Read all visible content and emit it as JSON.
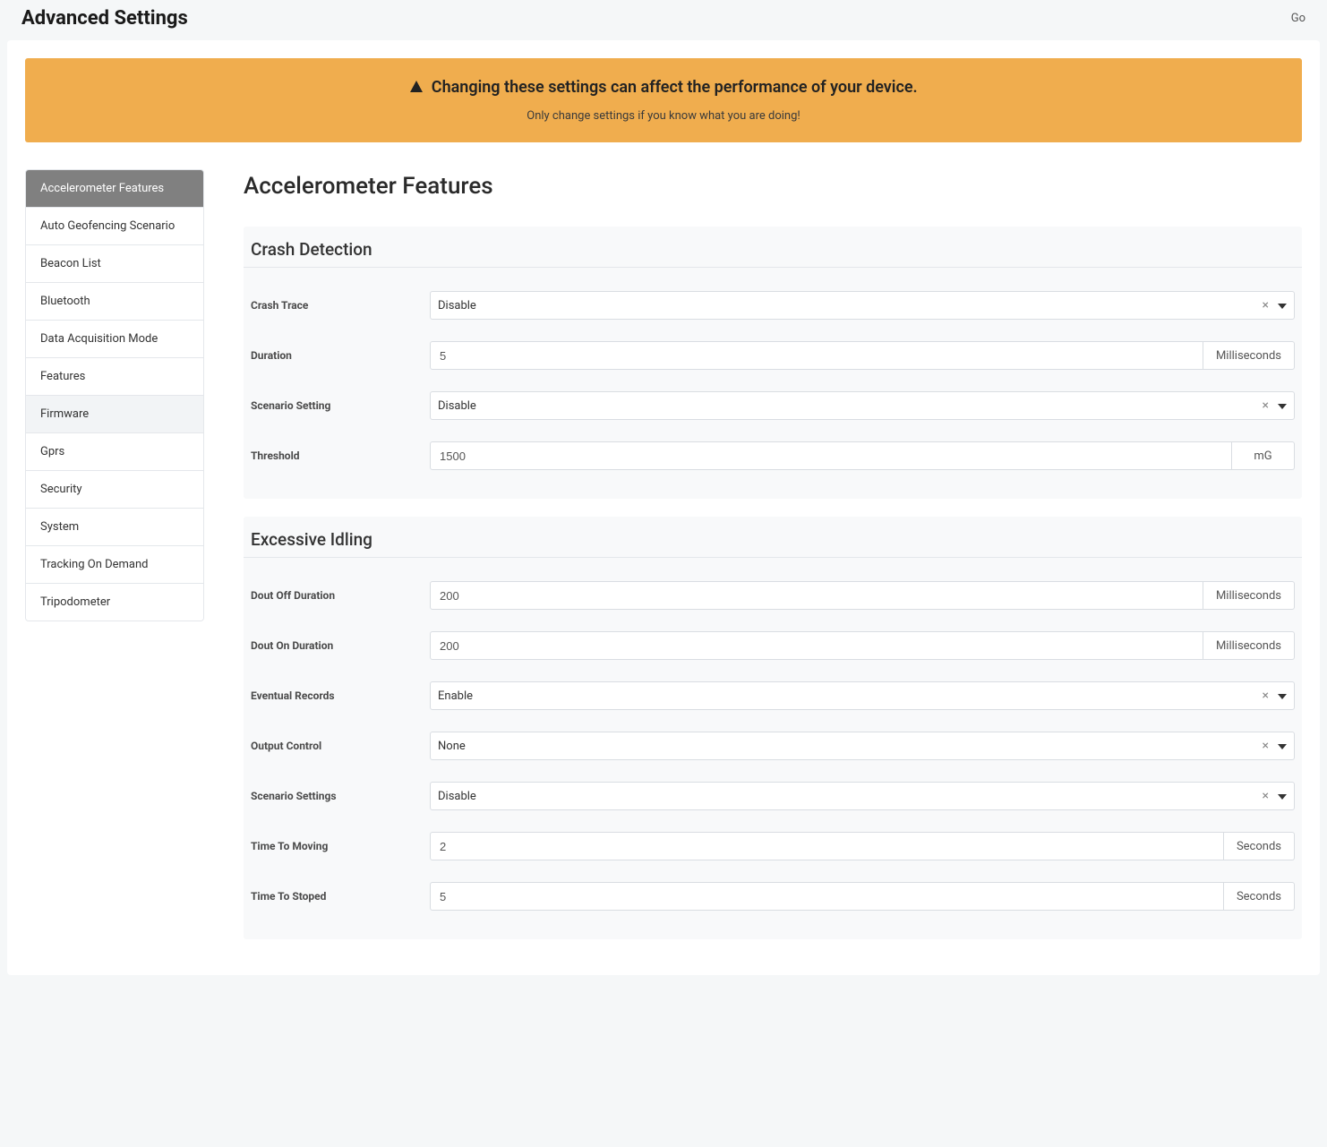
{
  "header": {
    "title": "Advanced Settings",
    "go": "Go"
  },
  "alert": {
    "title": "Changing these settings can affect the performance of your device.",
    "subtitle": "Only change settings if you know what you are doing!"
  },
  "sidebar": {
    "items": [
      {
        "label": "Accelerometer Features",
        "active": true
      },
      {
        "label": "Auto Geofencing Scenario"
      },
      {
        "label": "Beacon List"
      },
      {
        "label": "Bluetooth"
      },
      {
        "label": "Data Acquisition Mode"
      },
      {
        "label": "Features"
      },
      {
        "label": "Firmware",
        "hover": true
      },
      {
        "label": "Gprs"
      },
      {
        "label": "Security"
      },
      {
        "label": "System"
      },
      {
        "label": "Tracking On Demand"
      },
      {
        "label": "Tripodometer"
      }
    ]
  },
  "page": {
    "title": "Accelerometer Features"
  },
  "sections": {
    "crash": {
      "title": "Crash Detection",
      "crash_trace": {
        "label": "Crash Trace",
        "value": "Disable"
      },
      "duration": {
        "label": "Duration",
        "value": "5",
        "unit": "Milliseconds"
      },
      "scenario_setting": {
        "label": "Scenario Setting",
        "value": "Disable"
      },
      "threshold": {
        "label": "Threshold",
        "value": "1500",
        "unit": "mG"
      }
    },
    "idling": {
      "title": "Excessive Idling",
      "dout_off": {
        "label": "Dout Off Duration",
        "value": "200",
        "unit": "Milliseconds"
      },
      "dout_on": {
        "label": "Dout On Duration",
        "value": "200",
        "unit": "Milliseconds"
      },
      "eventual_records": {
        "label": "Eventual Records",
        "value": "Enable"
      },
      "output_control": {
        "label": "Output Control",
        "value": "None"
      },
      "scenario_settings": {
        "label": "Scenario Settings",
        "value": "Disable"
      },
      "time_to_moving": {
        "label": "Time To Moving",
        "value": "2",
        "unit": "Seconds"
      },
      "time_to_stoped": {
        "label": "Time To Stoped",
        "value": "5",
        "unit": "Seconds"
      }
    }
  }
}
